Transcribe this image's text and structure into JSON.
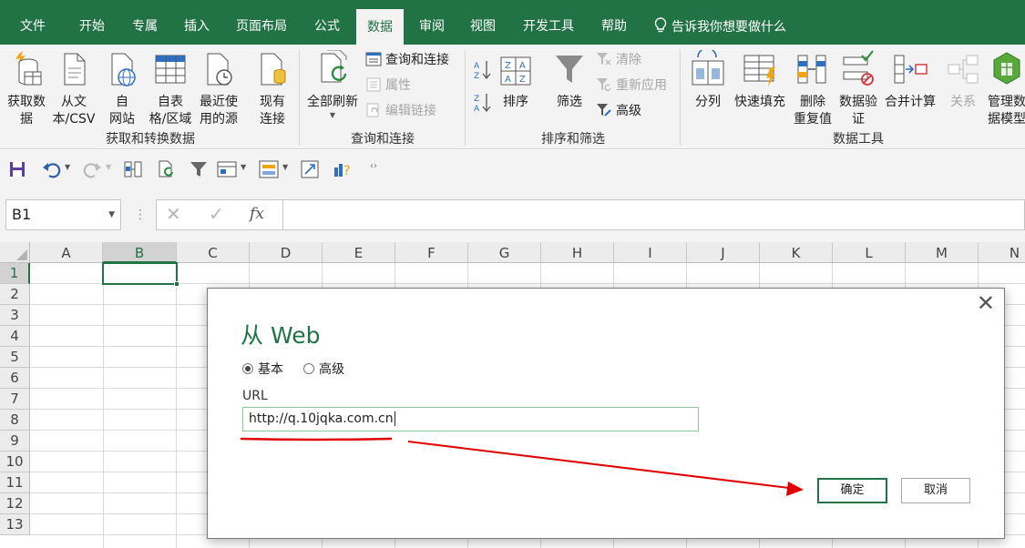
{
  "ribbon_tabs": [
    "文件",
    "开始",
    "专属",
    "插入",
    "页面布局",
    "公式",
    "数据",
    "审阅",
    "视图",
    "开发工具",
    "帮助"
  ],
  "active_tab": "数据",
  "tell_me": "告诉我你想要做什么",
  "groups": {
    "get_transform": {
      "label": "获取和转换数据",
      "buttons": [
        "获取数\n据",
        "从文\n本/CSV",
        "自\n网站",
        "自表\n格/区域",
        "最近使\n用的源",
        "现有\n连接"
      ]
    },
    "queries": {
      "label": "查询和连接",
      "refresh": "全部刷新",
      "items": [
        "查询和连接",
        "属性",
        "编辑链接"
      ]
    },
    "sort_filter": {
      "label": "排序和筛选",
      "sort": "排序",
      "filter": "筛选",
      "items": [
        "清除",
        "重新应用",
        "高级"
      ]
    },
    "data_tools": {
      "label": "数据工具",
      "buttons": [
        "分列",
        "快速填充",
        "删除\n重复值",
        "数据验\n证",
        "合并计算",
        "关系",
        "管理数\n据模型"
      ]
    }
  },
  "formula_bar": {
    "name_box": "B1",
    "fx": "fx",
    "value": ""
  },
  "grid": {
    "columns": [
      "A",
      "B",
      "C",
      "D",
      "E",
      "F",
      "G",
      "H",
      "I",
      "J",
      "K",
      "L",
      "M",
      "N"
    ],
    "rows": [
      "1",
      "2",
      "3",
      "4",
      "5",
      "6",
      "7",
      "8",
      "9",
      "10",
      "11",
      "12",
      "13"
    ],
    "selected_cell": "B1"
  },
  "dialog": {
    "title": "从 Web",
    "radio_basic": "基本",
    "radio_advanced": "高级",
    "selected_mode": "基本",
    "url_label": "URL",
    "url_value": "http://q.10jqka.com.cn",
    "ok_label": "确定",
    "cancel_label": "取消"
  },
  "colors": {
    "excel_green": "#217346",
    "annotation_red": "#e00000"
  }
}
